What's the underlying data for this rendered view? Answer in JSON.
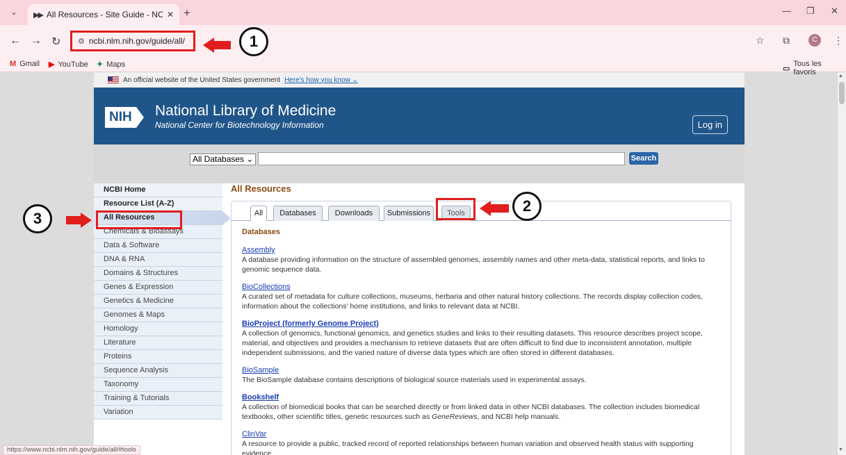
{
  "browser": {
    "tab_title": "All Resources - Site Guide - NC",
    "new_tab": "+",
    "tab_list_icon": "chevron-down-icon",
    "url": "ncbi.nlm.nih.gov/guide/all/",
    "bookmarks": [
      {
        "label": "Gmail",
        "icon": "gmail-icon"
      },
      {
        "label": "YouTube",
        "icon": "youtube-icon"
      },
      {
        "label": "Maps",
        "icon": "maps-icon"
      }
    ],
    "all_bookmarks": "Tous les favoris",
    "profile_initial": "C",
    "status_url": "https://www.ncbi.nlm.nih.gov/guide/all/#tools"
  },
  "annotations": {
    "callout_1": "1",
    "callout_2": "2",
    "callout_3": "3",
    "color": "#e11d1d"
  },
  "gov_banner": {
    "text": "An official website of the United States government",
    "link": "Here's how you know"
  },
  "header": {
    "logo": "NIH",
    "title": "National Library of Medicine",
    "subtitle": "National Center for Biotechnology Information",
    "login": "Log in",
    "color": "#20558a"
  },
  "search": {
    "database": "All Databases",
    "button": "Search"
  },
  "sidebar": {
    "items": [
      {
        "label": "NCBI Home"
      },
      {
        "label": "Resource List (A-Z)"
      },
      {
        "label": "All Resources"
      },
      {
        "label": "Chemicals & Bioassays"
      },
      {
        "label": "Data & Software"
      },
      {
        "label": "DNA & RNA"
      },
      {
        "label": "Domains & Structures"
      },
      {
        "label": "Genes & Expression"
      },
      {
        "label": "Genetics & Medicine"
      },
      {
        "label": "Genomes & Maps"
      },
      {
        "label": "Homology"
      },
      {
        "label": "Literature"
      },
      {
        "label": "Proteins"
      },
      {
        "label": "Sequence Analysis"
      },
      {
        "label": "Taxonomy"
      },
      {
        "label": "Training & Tutorials"
      },
      {
        "label": "Variation"
      }
    ]
  },
  "main": {
    "heading": "All Resources",
    "tabs": [
      {
        "label": "All"
      },
      {
        "label": "Databases"
      },
      {
        "label": "Downloads"
      },
      {
        "label": "Submissions"
      },
      {
        "label": "Tools"
      }
    ],
    "section": "Databases",
    "entries": [
      {
        "name": "Assembly",
        "desc": "A database providing information on the structure of assembled genomes, assembly names and other meta-data, statistical reports, and links to genomic sequence data."
      },
      {
        "name": "BioCollections",
        "desc": "A curated set of metadata for culture collections, museums, herbaria and other natural history collections. The records display collection codes, information about the collections' home institutions, and links to relevant data at NCBI."
      },
      {
        "name": "BioProject (formerly Genome Project)",
        "desc": "A collection of genomics, functional genomics, and genetics studies and links to their resulting datasets. This resource describes project scope, material, and objectives and provides a mechanism to retrieve datasets that are often difficult to find due to inconsistent annotation, multiple independent submissions, and the varied nature of diverse data types which are often stored in different databases."
      },
      {
        "name": "BioSample",
        "desc": "The BioSample database contains descriptions of biological source materials used in experimental assays."
      },
      {
        "name": "Bookshelf",
        "desc_parts": [
          "A collection of biomedical books that can be searched directly or from linked data in other NCBI databases. The collection includes biomedical textbooks, other scientific titles, genetic resources such as ",
          "GeneReviews",
          ", and NCBI help manuals."
        ]
      },
      {
        "name": "ClinVar",
        "desc": "A resource to provide a public, tracked record of reported relationships between human variation and observed health status with supporting evidence."
      }
    ]
  }
}
